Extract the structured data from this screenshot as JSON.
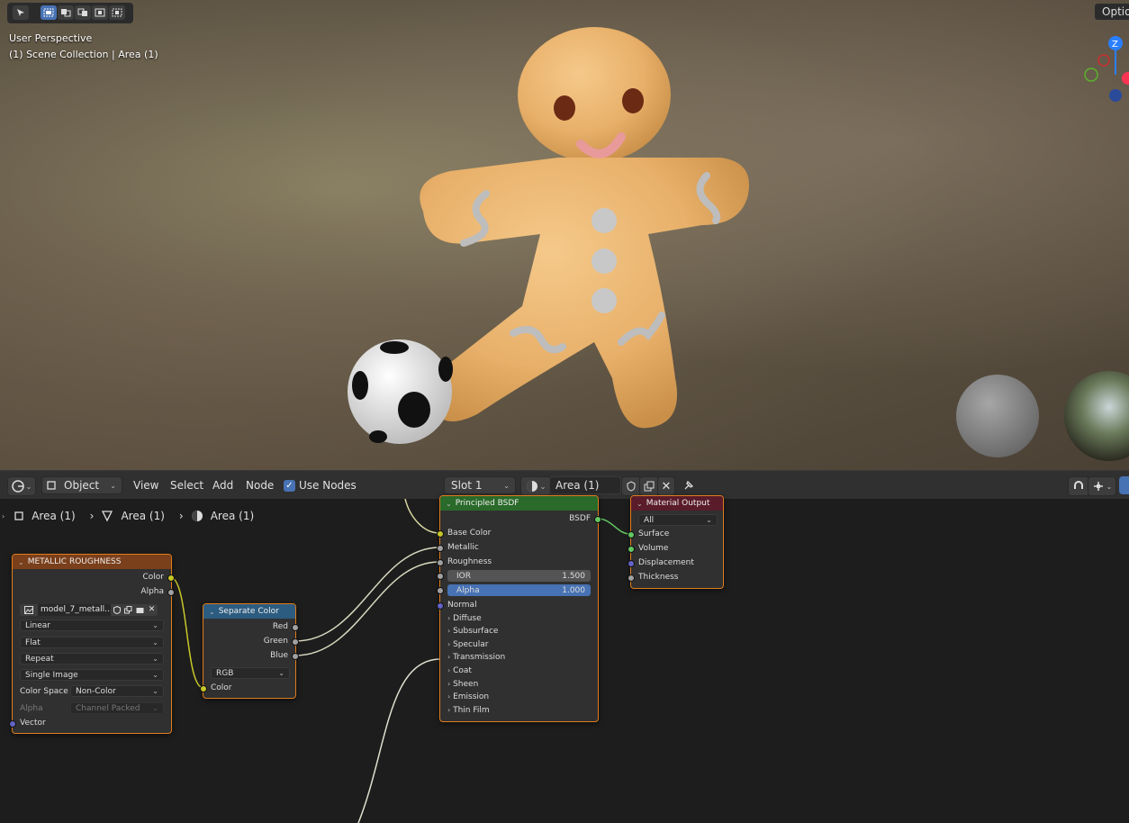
{
  "viewport": {
    "perspective_label": "User Perspective",
    "collection_label": "(1) Scene Collection | Area (1)",
    "options_label": "Optio"
  },
  "header": {
    "editor_mode": "Object",
    "menus": [
      "View",
      "Select",
      "Add",
      "Node"
    ],
    "use_nodes_label": "Use Nodes",
    "slot_label": "Slot 1",
    "material_name": "Area (1)"
  },
  "breadcrumb": [
    "Area (1)",
    "Area (1)",
    "Area (1)"
  ],
  "nodes": {
    "metallic": {
      "title": "METALLIC ROUGHNESS",
      "out_color": "Color",
      "out_alpha": "Alpha",
      "image_name": "model_7_metall...",
      "interpolation": "Linear",
      "projection": "Flat",
      "extension": "Repeat",
      "source": "Single Image",
      "color_space_label": "Color Space",
      "color_space_value": "Non-Color",
      "alpha_label": "Alpha",
      "alpha_value": "Channel Packed",
      "in_vector": "Vector"
    },
    "separate": {
      "title": "Separate Color",
      "out_red": "Red",
      "out_green": "Green",
      "out_blue": "Blue",
      "mode": "RGB",
      "in_color": "Color"
    },
    "principled": {
      "title": "Principled BSDF",
      "out_bsdf": "BSDF",
      "base_color": "Base Color",
      "metallic": "Metallic",
      "roughness": "Roughness",
      "ior_label": "IOR",
      "ior_value": "1.500",
      "alpha_label": "Alpha",
      "alpha_value": "1.000",
      "normal": "Normal",
      "panels": [
        "Diffuse",
        "Subsurface",
        "Specular",
        "Transmission",
        "Coat",
        "Sheen",
        "Emission",
        "Thin Film"
      ]
    },
    "output": {
      "title": "Material Output",
      "target": "All",
      "surface": "Surface",
      "volume": "Volume",
      "displacement": "Displacement",
      "thickness": "Thickness"
    }
  },
  "gizmo": {
    "z_label": "Z"
  },
  "colors": {
    "accent": "#4772b3",
    "node_border": "#e07c1c",
    "texture_header": "#7a3f1b",
    "converter_header": "#2c5c80",
    "shader_header": "#2a6a2a",
    "output_header": "#5a1c2a"
  }
}
